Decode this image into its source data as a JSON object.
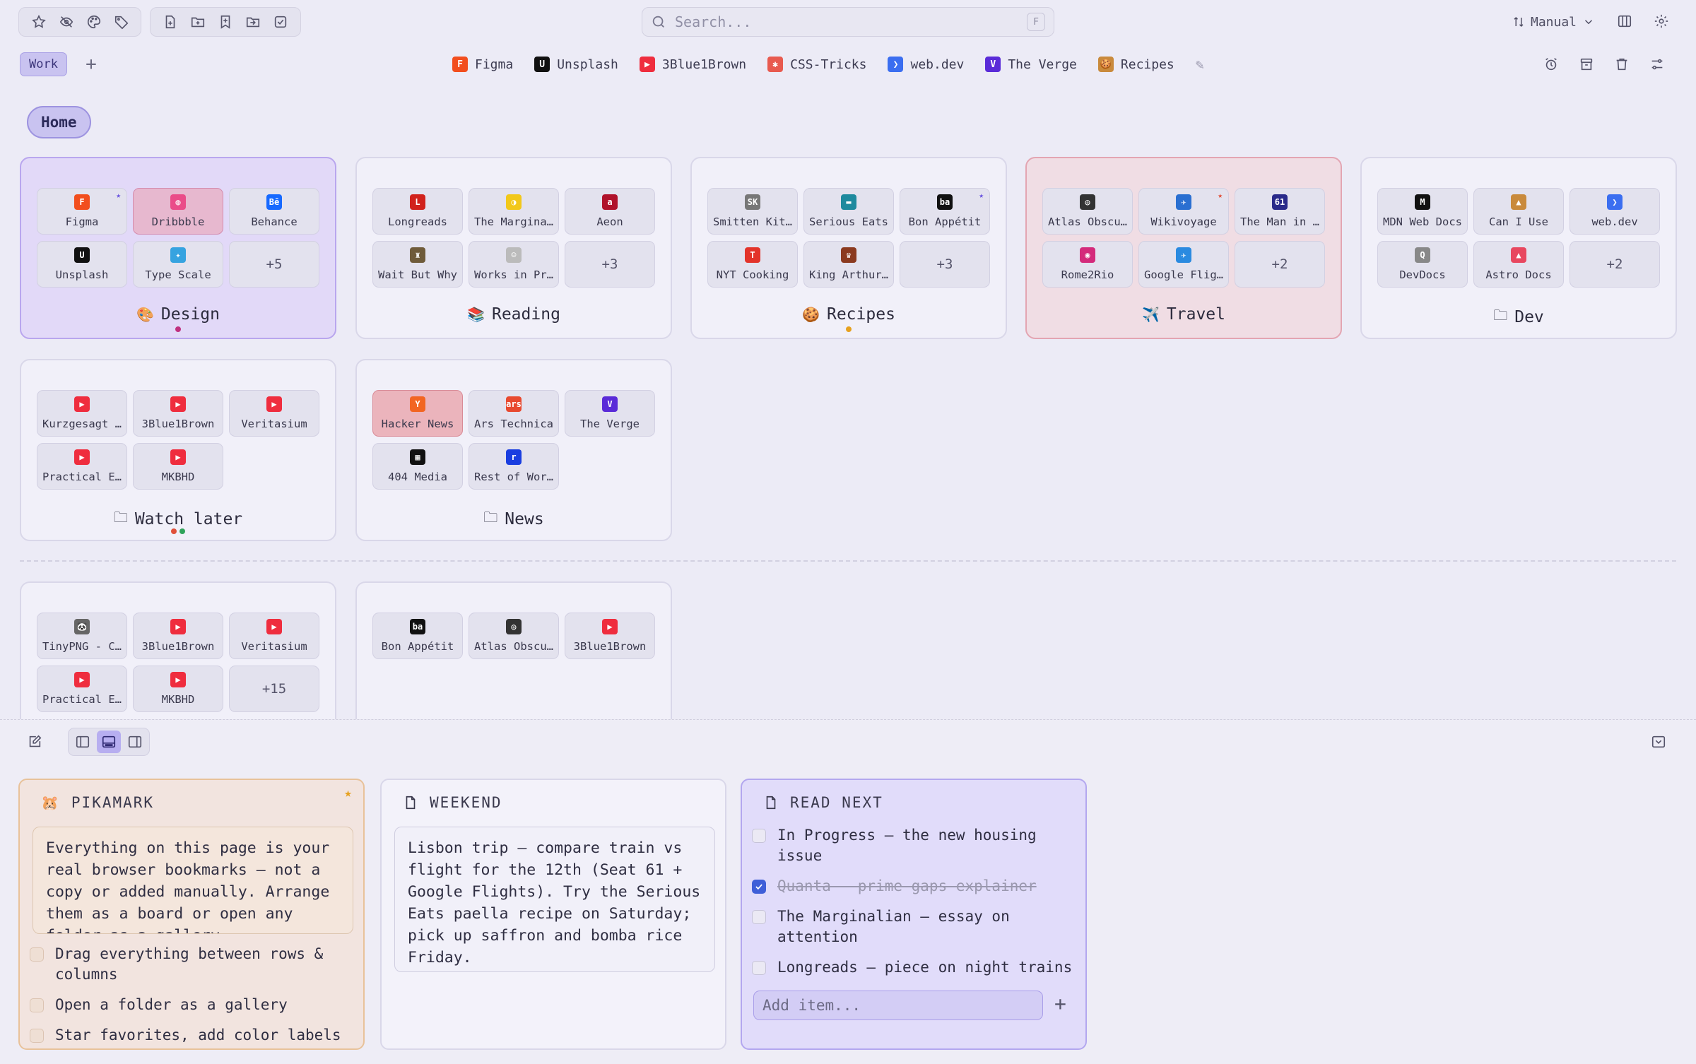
{
  "toolbar": {
    "search_placeholder": "Search...",
    "search_shortcut": "F",
    "sort_label": "Manual"
  },
  "workspace": {
    "tab": "Work",
    "add": "+"
  },
  "favorites": [
    {
      "label": "Figma",
      "color": "#f24e1e",
      "glyph": "F"
    },
    {
      "label": "Unsplash",
      "color": "#111111",
      "glyph": "U"
    },
    {
      "label": "3Blue1Brown",
      "color": "#ef2d3e",
      "glyph": "▶"
    },
    {
      "label": "CSS-Tricks",
      "color": "#e85a4f",
      "glyph": "✱"
    },
    {
      "label": "web.dev",
      "color": "#3b6ef0",
      "glyph": "❯"
    },
    {
      "label": "The Verge",
      "color": "#5a2bd8",
      "glyph": "V"
    },
    {
      "label": "Recipes",
      "color": "#c98a3c",
      "glyph": "🍪"
    }
  ],
  "home": "Home",
  "cards": [
    {
      "title": "Design",
      "emoji": "🎨",
      "style": "purple",
      "dots": [
        "#c0307f"
      ],
      "tiles": [
        {
          "label": "Figma",
          "color": "#f24e1e",
          "glyph": "F",
          "star": true
        },
        {
          "label": "Dribbble",
          "color": "#ea4c89",
          "glyph": "◍",
          "hl": true
        },
        {
          "label": "Behance",
          "color": "#1769ff",
          "glyph": "Bē"
        },
        {
          "label": "Unsplash",
          "color": "#111111",
          "glyph": "U"
        },
        {
          "label": "Type Scale",
          "color": "#36a3e0",
          "glyph": "✦"
        },
        {
          "more": "+5"
        }
      ]
    },
    {
      "title": "Reading",
      "emoji": "📚",
      "style": "",
      "dots": [],
      "tiles": [
        {
          "label": "Longreads",
          "color": "#d1221c",
          "glyph": "L"
        },
        {
          "label": "The Margina…",
          "color": "#f2c81a",
          "glyph": "◑"
        },
        {
          "label": "Aeon",
          "color": "#b0122b",
          "glyph": "a"
        },
        {
          "label": "Wait But Why",
          "color": "#6f5b3a",
          "glyph": "♜"
        },
        {
          "label": "Works in Pr…",
          "color": "#bbbbbb",
          "glyph": "☺"
        },
        {
          "more": "+3"
        }
      ]
    },
    {
      "title": "Recipes",
      "emoji": "🍪",
      "style": "",
      "dots": [
        "#e6a11f"
      ],
      "tiles": [
        {
          "label": "Smitten Kit…",
          "color": "#777777",
          "glyph": "SK"
        },
        {
          "label": "Serious Eats",
          "color": "#1e8a9e",
          "glyph": "▬"
        },
        {
          "label": "Bon Appétit",
          "color": "#111111",
          "glyph": "ba",
          "star": true
        },
        {
          "label": "NYT Cooking",
          "color": "#e3332a",
          "glyph": "T"
        },
        {
          "label": "King Arthur…",
          "color": "#8b3a1f",
          "glyph": "♛"
        },
        {
          "more": "+3"
        }
      ]
    },
    {
      "title": "Travel",
      "emoji": "✈️",
      "style": "red",
      "dots": [],
      "tiles": [
        {
          "label": "Atlas Obscu…",
          "color": "#333333",
          "glyph": "◎"
        },
        {
          "label": "Wikivoyage",
          "color": "#2a6fd1",
          "glyph": "✈",
          "star": true,
          "starRed": true
        },
        {
          "label": "The Man in …",
          "color": "#2a2a8a",
          "glyph": "61"
        },
        {
          "label": "Rome2Rio",
          "color": "#d42a7b",
          "glyph": "◉"
        },
        {
          "label": "Google Flig…",
          "color": "#2a8ae0",
          "glyph": "✈"
        },
        {
          "more": "+2"
        }
      ]
    },
    {
      "title": "Dev",
      "emoji": "🗀",
      "style": "",
      "dots": [],
      "tiles": [
        {
          "label": "MDN Web Docs",
          "color": "#111111",
          "glyph": "M"
        },
        {
          "label": "Can I Use",
          "color": "#c98a3c",
          "glyph": "▲"
        },
        {
          "label": "web.dev",
          "color": "#3b6ef0",
          "glyph": "❯"
        },
        {
          "label": "DevDocs",
          "color": "#888888",
          "glyph": "Q"
        },
        {
          "label": "Astro Docs",
          "color": "#e8475f",
          "glyph": "▲"
        },
        {
          "more": "+2"
        }
      ]
    },
    {
      "title": "Watch later",
      "emoji": "🗀",
      "style": "",
      "dots": [
        "#e0503a",
        "#2fa35a"
      ],
      "tiles": [
        {
          "label": "Kurzgesagt …",
          "color": "#ef2d3e",
          "glyph": "▶"
        },
        {
          "label": "3Blue1Brown",
          "color": "#ef2d3e",
          "glyph": "▶"
        },
        {
          "label": "Veritasium",
          "color": "#ef2d3e",
          "glyph": "▶"
        },
        {
          "label": "Practical E…",
          "color": "#ef2d3e",
          "glyph": "▶"
        },
        {
          "label": "MKBHD",
          "color": "#ef2d3e",
          "glyph": "▶"
        }
      ]
    },
    {
      "title": "News",
      "emoji": "🗀",
      "style": "",
      "dots": [],
      "tiles": [
        {
          "label": "Hacker News",
          "color": "#f26522",
          "glyph": "Y",
          "hlRed": true
        },
        {
          "label": "Ars Technica",
          "color": "#e8492f",
          "glyph": "ars"
        },
        {
          "label": "The Verge",
          "color": "#5a2bd8",
          "glyph": "V"
        },
        {
          "label": "404 Media",
          "color": "#111111",
          "glyph": "▦"
        },
        {
          "label": "Rest of Wor…",
          "color": "#1a3ee0",
          "glyph": "r"
        }
      ]
    },
    {
      "title": "",
      "emoji": "",
      "style": "cut",
      "dots": [],
      "tiles": [
        {
          "label": "TinyPNG - C…",
          "color": "#666666",
          "glyph": "🐼"
        },
        {
          "label": "3Blue1Brown",
          "color": "#ef2d3e",
          "glyph": "▶"
        },
        {
          "label": "Veritasium",
          "color": "#ef2d3e",
          "glyph": "▶"
        },
        {
          "label": "Practical E…",
          "color": "#ef2d3e",
          "glyph": "▶"
        },
        {
          "label": "MKBHD",
          "color": "#ef2d3e",
          "glyph": "▶"
        },
        {
          "more": "+15"
        }
      ]
    },
    {
      "title": "",
      "emoji": "",
      "style": "cut",
      "dots": [],
      "tiles": [
        {
          "label": "Bon Appétit",
          "color": "#111111",
          "glyph": "ba"
        },
        {
          "label": "Atlas Obscu…",
          "color": "#333333",
          "glyph": "◎"
        },
        {
          "label": "3Blue1Brown",
          "color": "#ef2d3e",
          "glyph": "▶"
        }
      ]
    }
  ],
  "notes": {
    "pikamark": {
      "title": "PIKAMARK",
      "text": "Everything on this page is your real browser bookmarks — not a copy or added manually. Arrange them as a board or open any folder as a gallery.",
      "items": [
        {
          "text": "Drag everything between rows & columns",
          "done": false
        },
        {
          "text": "Open a folder as a gallery",
          "done": false
        },
        {
          "text": "Star favorites, add color labels",
          "done": false
        }
      ]
    },
    "weekend": {
      "title": "WEEKEND",
      "text": "Lisbon trip — compare train vs flight for the 12th (Seat 61 + Google Flights). Try the Serious Eats paella recipe on Saturday; pick up saffron and bomba rice Friday."
    },
    "read_next": {
      "title": "READ NEXT",
      "items": [
        {
          "text": "In Progress — the new housing issue",
          "done": false
        },
        {
          "text": "Quanta — prime gaps explainer",
          "done": true
        },
        {
          "text": "The Marginalian — essay on attention",
          "done": false
        },
        {
          "text": "Longreads — piece on night trains",
          "done": false
        }
      ],
      "add_placeholder": "Add item...",
      "add_button": "+"
    }
  }
}
